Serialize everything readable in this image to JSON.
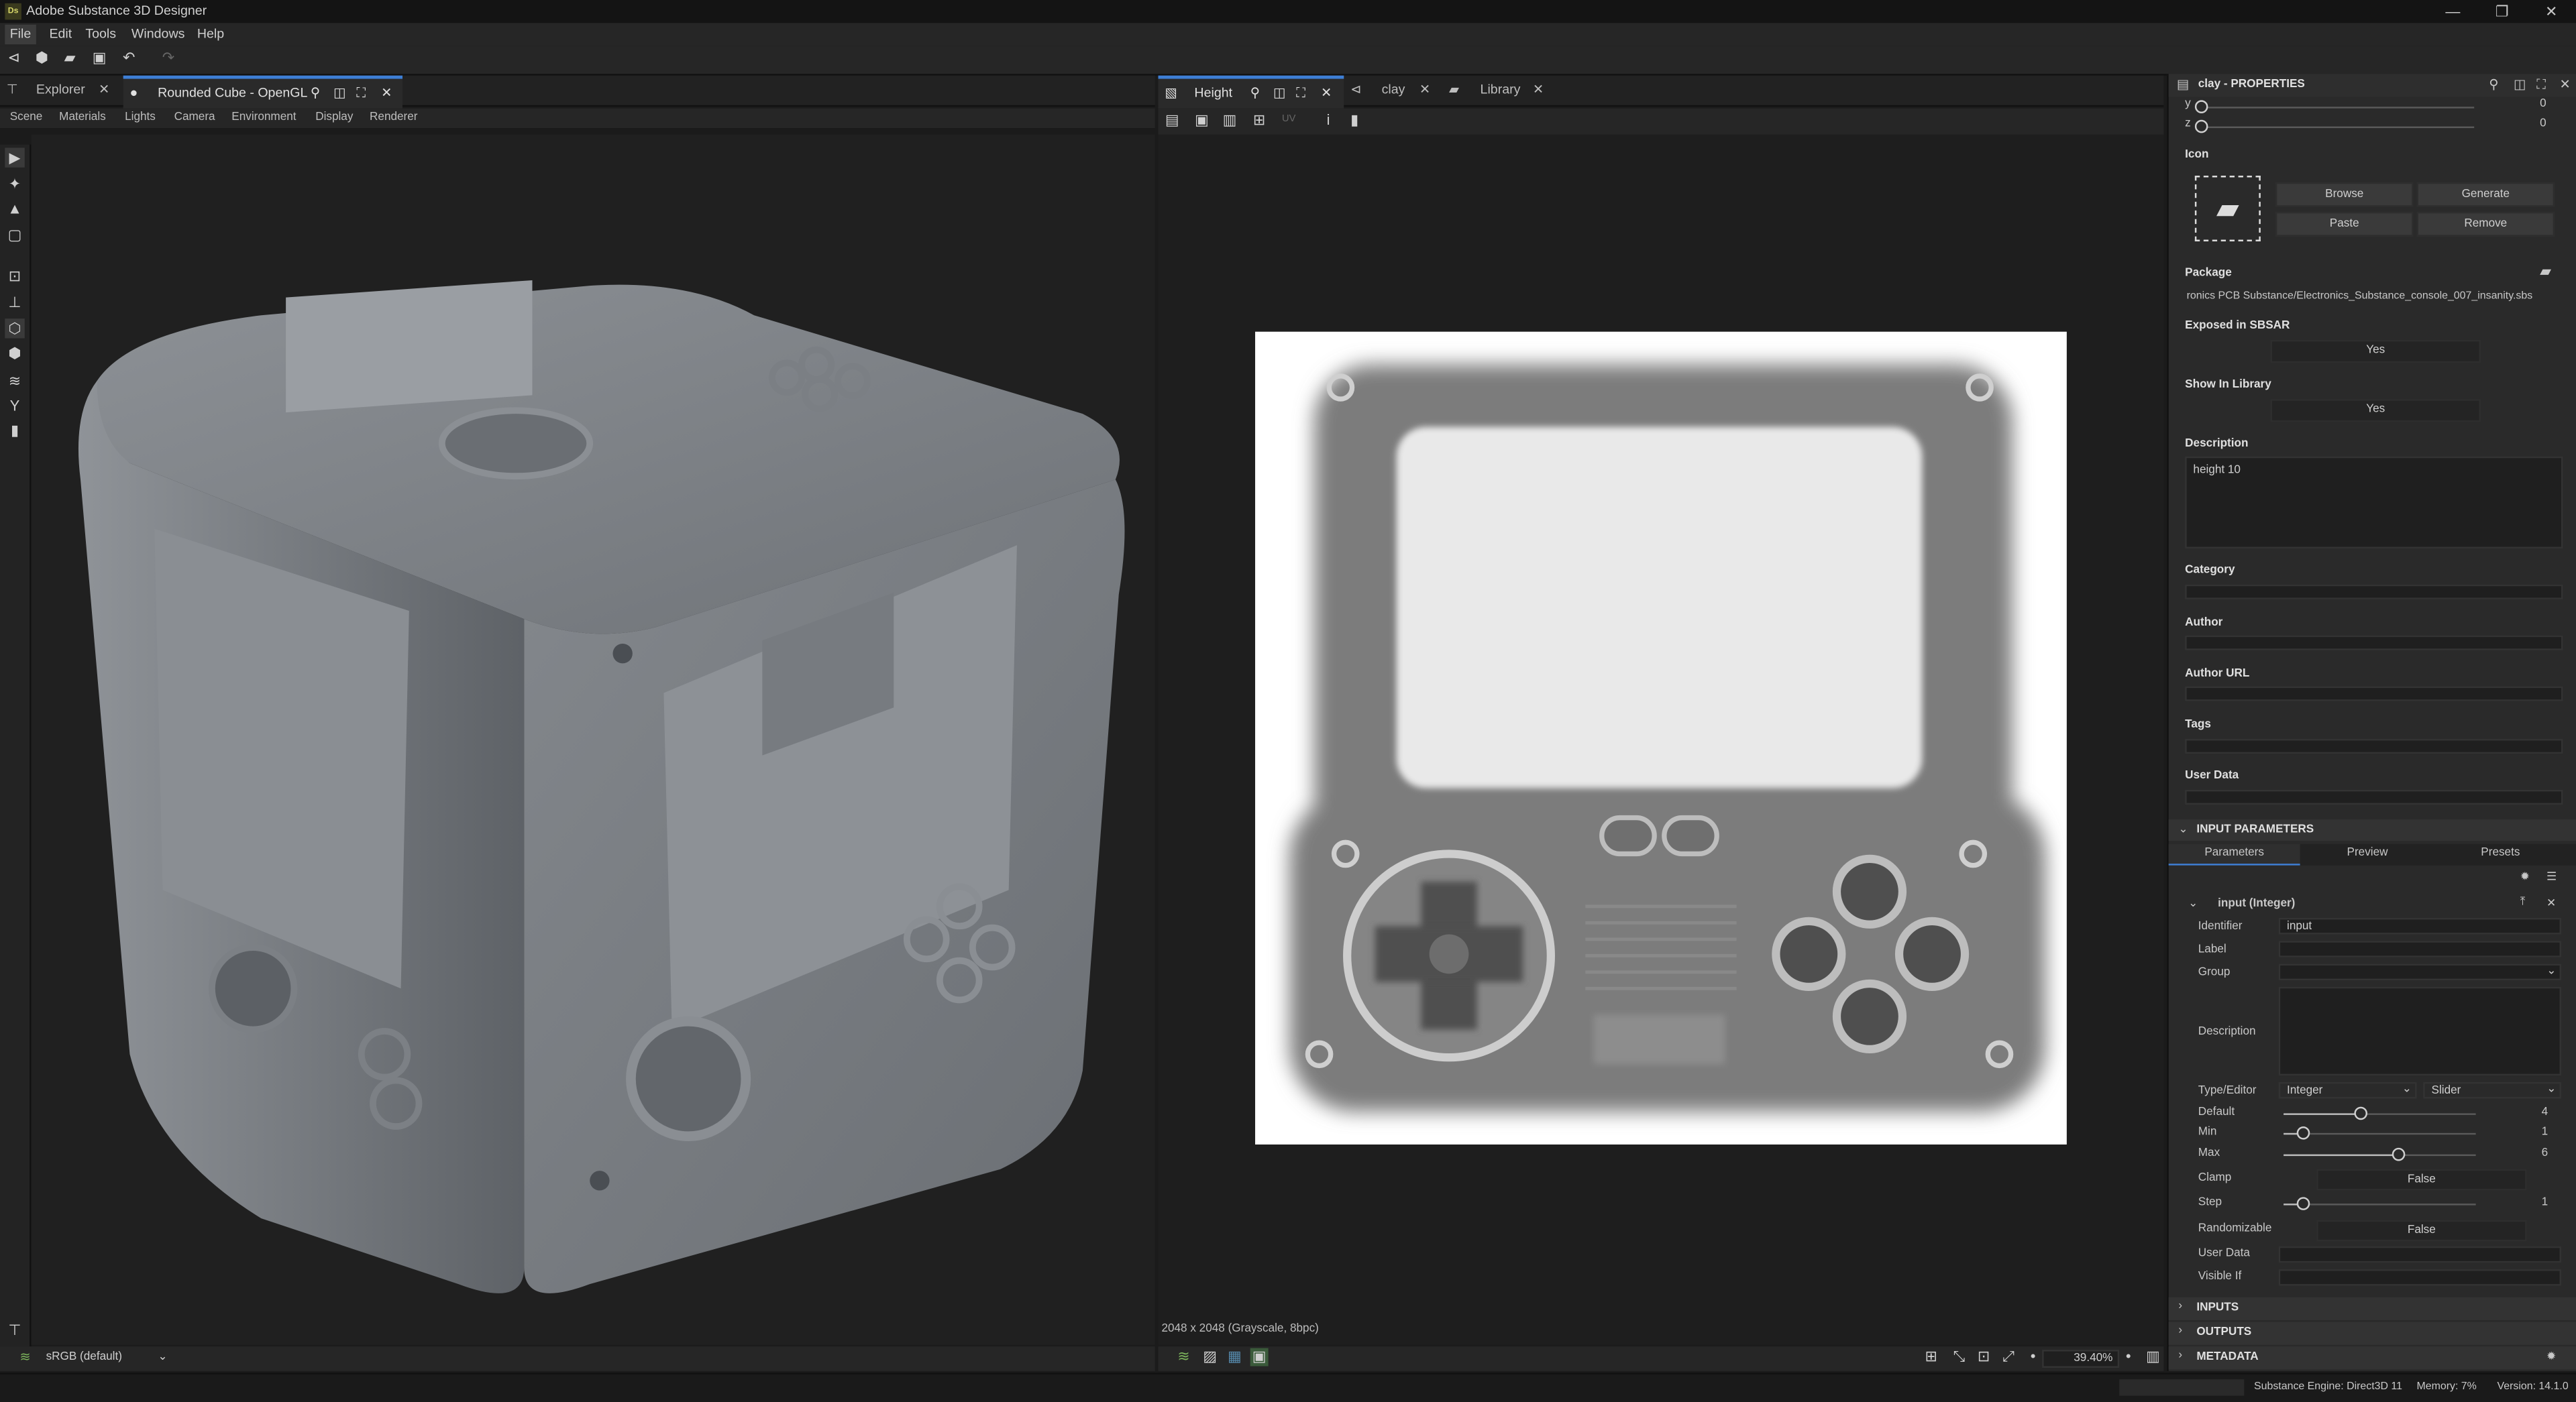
{
  "app": {
    "title": "Adobe Substance 3D Designer",
    "logo_text": "Ds"
  },
  "menu": [
    "File",
    "Edit",
    "Tools",
    "Windows",
    "Help"
  ],
  "left_panel": {
    "tabs": [
      {
        "label": "Explorer"
      },
      {
        "label": "Rounded Cube - OpenGL"
      }
    ],
    "menu": [
      "Scene",
      "Materials",
      "Lights",
      "Camera",
      "Environment",
      "Display",
      "Renderer"
    ],
    "color_space": "sRGB (default)"
  },
  "center_panel": {
    "tabs": [
      {
        "label": "Height"
      },
      {
        "label": "clay"
      },
      {
        "label": "Library"
      }
    ],
    "uv_label": "UV",
    "image_info": "2048 x 2048 (Grayscale, 8bpc)",
    "zoom": "39.40%"
  },
  "props": {
    "title": "clay - PROPERTIES",
    "y_label": "y",
    "y_value": "0",
    "z_label": "z",
    "z_value": "0",
    "icon_label": "Icon",
    "browse": "Browse",
    "generate": "Generate",
    "paste": "Paste",
    "remove": "Remove",
    "package_label": "Package",
    "package_value": "ronics PCB Substance/Electronics_Substance_console_007_insanity.sbs",
    "exposed_label": "Exposed in SBSAR",
    "exposed_value": "Yes",
    "show_label": "Show In Library",
    "show_value": "Yes",
    "description_label": "Description",
    "description_value": "height 10",
    "category_label": "Category",
    "author_label": "Author",
    "author_url_label": "Author URL",
    "tags_label": "Tags",
    "user_data_label": "User Data",
    "input_params": "INPUT PARAMETERS",
    "sub_tabs": [
      "Parameters",
      "Preview",
      "Presets"
    ],
    "param_title": "input (Integer)",
    "identifier_label": "Identifier",
    "identifier_value": "input",
    "label_label": "Label",
    "group_label": "Group",
    "desc_label": "Description",
    "type_label": "Type/Editor",
    "type_value": "Integer",
    "editor_value": "Slider",
    "default_label": "Default",
    "default_value": "4",
    "min_label": "Min",
    "min_value": "1",
    "max_label": "Max",
    "max_value": "6",
    "clamp_label": "Clamp",
    "clamp_value": "False",
    "step_label": "Step",
    "step_value": "1",
    "random_label": "Randomizable",
    "random_value": "False",
    "user_data2_label": "User Data",
    "visible_label": "Visible If",
    "inputs": "INPUTS",
    "outputs": "OUTPUTS",
    "metadata": "METADATA"
  },
  "status": {
    "engine": "Substance Engine: Direct3D 11",
    "memory": "Memory: 7%",
    "version": "Version: 14.1.0"
  }
}
